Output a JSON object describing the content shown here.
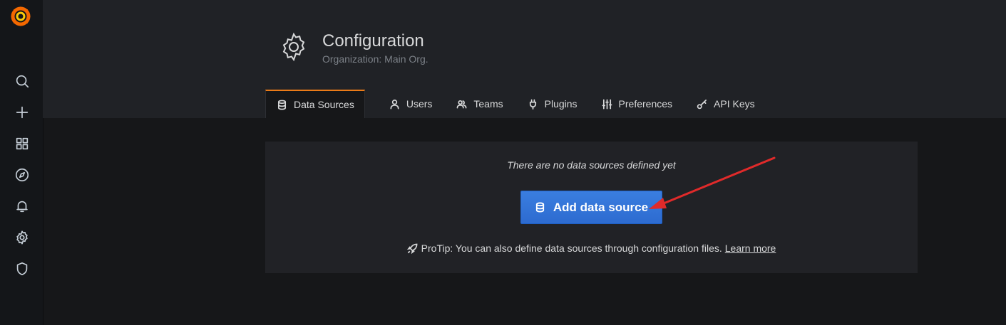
{
  "header": {
    "title": "Configuration",
    "subtitle": "Organization: Main Org."
  },
  "tabs": [
    {
      "label": "Data Sources",
      "icon": "database-icon",
      "active": true
    },
    {
      "label": "Users",
      "icon": "user-icon"
    },
    {
      "label": "Teams",
      "icon": "users-icon"
    },
    {
      "label": "Plugins",
      "icon": "plug-icon"
    },
    {
      "label": "Preferences",
      "icon": "sliders-icon"
    },
    {
      "label": "API Keys",
      "icon": "key-icon"
    }
  ],
  "sidemenu": [
    "grafana-logo",
    "search-icon",
    "plus-icon",
    "dashboards-icon",
    "explore-icon",
    "alerting-icon",
    "configuration-icon",
    "shield-icon"
  ],
  "empty_state": {
    "message": "There are no data sources defined yet",
    "button_label": "Add data source",
    "protip": "ProTip: You can also define data sources through configuration files.",
    "learn_more": "Learn more"
  },
  "colors": {
    "accent": "#eb7b18",
    "primary_button": "#3274d9",
    "annotation_arrow": "#e02a2a"
  }
}
